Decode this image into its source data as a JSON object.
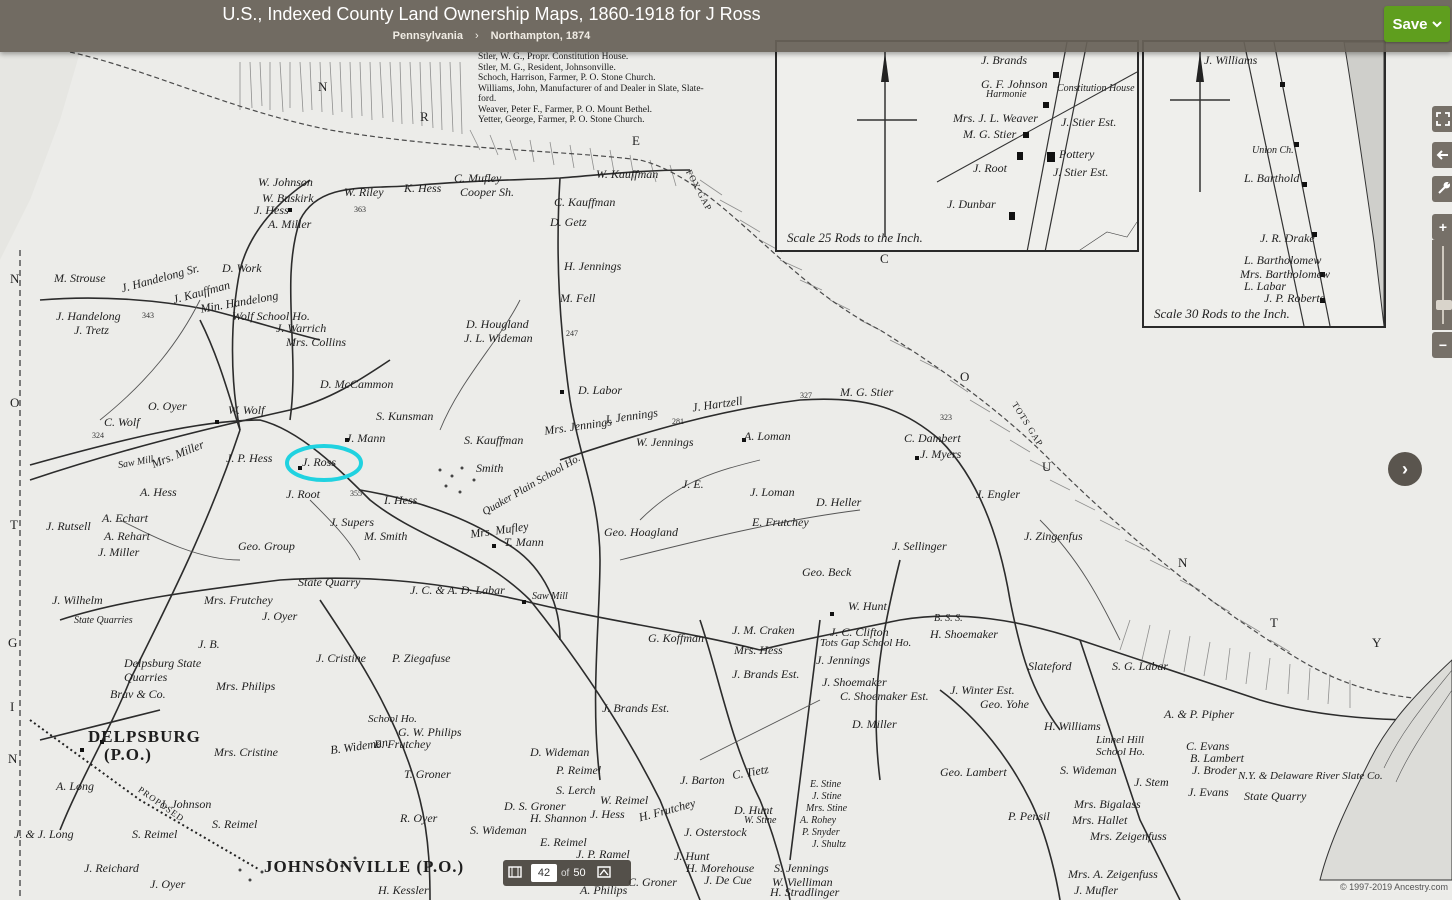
{
  "header": {
    "title": "U.S., Indexed County Land Ownership Maps, 1860-1918 for J Ross",
    "breadcrumb_state": "Pennsylvania",
    "breadcrumb_separator": "›",
    "breadcrumb_location": "Northampton, 1874",
    "save_label": "Save",
    "save_color": "#5f9e1e"
  },
  "tools": {
    "fullscreen_icon": "fullscreen-icon",
    "back_icon": "back-arrow-icon",
    "tools_icon": "wrench-icon",
    "zoom_in": "+",
    "zoom_out": "−",
    "next_icon": "›"
  },
  "pager": {
    "current": "42",
    "of": "of",
    "total": "50"
  },
  "copyright": "© 1997-2019 Ancestry.com",
  "highlight_color": "#20d2e0",
  "map": {
    "legend": [
      "Stler, W. G., Propr. Constitution House.",
      "Stler, M. G., Resident, Johnsonville.",
      "Schoch, Harrison, Farmer, P. O. Stone Church.",
      "Williams, John, Manufacturer of and Dealer in Slate, Slate-",
      "    ford.",
      "Weaver, Peter F., Farmer, P. O. Mount Bethel.",
      "Yetter, George, Farmer, P. O. Stone Church."
    ],
    "inset1_scale": "Scale 25 Rods to the Inch.",
    "inset2_scale": "Scale 30 Rods to the Inch.",
    "labels": {
      "l1": "W. Johnson",
      "l2": "W. Buskirk",
      "l3": "J. Hess",
      "l4": "A. Miller",
      "l5": "W. Riley",
      "l6": "K. Hess",
      "l7": "C. Mufley",
      "l8": "Cooper Sh.",
      "l9": "W. Kauffman",
      "l10": "C. Kauffman",
      "l11": "D. Getz",
      "l12": "H. Jennings",
      "l13": "M. Fell",
      "l14": "M. Strouse",
      "l15": "J. Handelong Sr.",
      "l16": "J. Kauffman",
      "l17": "Min. Handelong",
      "l18": "D. Work",
      "l19": "J. Handelong",
      "l20": "J. Tretz",
      "l21": "Wolf School Ho.",
      "l22": "J. Warrich",
      "l23": "Mrs. Collins",
      "l24": "D. Hougland",
      "l25": "J. L. Wideman",
      "l26": "D. McCammon",
      "l27": "D. Labor",
      "l28": "O. Oyer",
      "l29": "C. Wolf",
      "l30": "W. Wolf",
      "l31": "S. Kunsman",
      "l32": "J. Mann",
      "l33": "J. Jennings",
      "l34": "Mrs. Jennings",
      "l35": "J. Hartzell",
      "l36": "M. G. Stier",
      "l37": "S. Kauffman",
      "l38": "W. Jennings",
      "l39": "A. Loman",
      "l40": "C. Dambert",
      "l41": "J. Myers",
      "l42": "J. P. Hess",
      "l43": "J. Ross",
      "l44": "Smith",
      "l45": "Quaker Plain School Ho.",
      "l46": "Mrs. Miller",
      "l47": "Saw Mill",
      "l48": "J. E.",
      "l49": "J. Loman",
      "l50": "D. Heller",
      "l51": "J. Engler",
      "l52": "A. Hess",
      "l53": "J. Root",
      "l54": "I. Hess",
      "l55": "A. Echart",
      "l56": "J. Rutsell",
      "l57": "A. Rehart",
      "l58": "J. Supers",
      "l59": "M. Smith",
      "l60": "Mrs. Mufley",
      "l61": "T. Mann",
      "l62": "Geo. Hoagland",
      "l63": "E. Frutchey",
      "l64": "J. Zingenfus",
      "l65": "J. Miller",
      "l66": "Geo. Group",
      "l67": "J. Sellinger",
      "l68": "Geo. Beck",
      "l69": "State Quarry",
      "l70": "J. C. & A. D. Labar",
      "l71": "Saw Mill",
      "l72": "J. Wilhelm",
      "l73": "Mrs. Frutchey",
      "l74": "J. Oyer",
      "l75": "State Quarries",
      "l76": "W. Hunt",
      "l77": "B. S. S.",
      "l78": "H. Shoemaker",
      "l79": "J. B.",
      "l80": "G. Koffman",
      "l81": "J. M. Craken",
      "l82": "J. C. Clifton",
      "l83": "Tots Gap School Ho.",
      "l84": "Mrs. Hess",
      "l85": "J. Jennings",
      "l86": "Slateford",
      "l87": "S. G. Labar",
      "l88": "J. Cristine",
      "l89": "P. Ziegafuse",
      "l90": "Delpsburg State Quarries",
      "l91": "Mrs. Philips",
      "l92": "J. Brands Est.",
      "l93": "J. Shoemaker",
      "l94": "C. Shoemaker Est.",
      "l95": "J. Winter Est.",
      "l96": "Geo. Yohe",
      "l97": "Brav & Co.",
      "l98": "J. Brands Est.",
      "l99": "D. Miller",
      "l100": "H. Williams",
      "l101": "A. & P. Pipher",
      "l102": "School Ho.",
      "l103": "G. W. Philips",
      "l104": "Mrs. Cristine",
      "l105": "B. Wideman",
      "l106": "E. Frutchey",
      "l107": "Linnel Hill School Ho.",
      "l108": "C. Evans",
      "l109": "B. Lambert",
      "l110": "J. Broder",
      "l111": "D. Wideman",
      "l112": "P. Reimel",
      "l113": "J. Barton",
      "l114": "C. Tietz",
      "l115": "Geo. Lambert",
      "l116": "S. Wideman",
      "l117": "N.Y. & Delaware River Slate Co.",
      "l118": "A. Long",
      "l119": "T. Groner",
      "l120": "S. Lerch",
      "l121": "W. Reimel",
      "l122": "E. Stine",
      "l123": "J. Stine",
      "l124": "Mrs. Stine",
      "l125": "J. Stem",
      "l126": "J. Evans",
      "l127": "State Quarry",
      "l128": "J. Johnson",
      "l129": "D. S. Groner",
      "l130": "H. Shannon",
      "l131": "J. Hess",
      "l132": "H. Frutchey",
      "l133": "D. Hunt",
      "l134": "W. Stine",
      "l135": "A. Rohey",
      "l136": "P. Snyder",
      "l137": "J. Shultz",
      "l138": "P. Pensil",
      "l139": "Mrs. Bigalass",
      "l140": "Mrs. Hallet",
      "l141": "Mrs. Zeigenfuss",
      "l142": "J. & J. Long",
      "l143": "S. Reimel",
      "l144": "S. Reimel",
      "l145": "R. Oyer",
      "l146": "S. Wideman",
      "l147": "J. Osterstock",
      "l148": "J. Reichard",
      "l149": "J. Oyer",
      "l150": "H. Kessler",
      "l151": "E. Reimel",
      "l152": "J. P. Ramel",
      "l153": "A. Philips",
      "l154": "J. Hunt",
      "l155": "H. Morehouse",
      "l156": "J. De Cue",
      "l157": "S. Jennings",
      "l158": "W. Vielliman",
      "l159": "H. Stradlinger",
      "l160": "C. Groner",
      "l161": "Mrs. A. Zeigenfuss",
      "l162": "J. Mufler",
      "l163": "DELPSBURG",
      "l164": "(P.O.)",
      "l165": "JOHNSONVILLE (P.O.)",
      "l166": "N",
      "l167": "R",
      "l168": "E",
      "l169": "R",
      "l170": "I",
      "l171": "C",
      "l172": "O",
      "l173": "U",
      "l174": "N",
      "l175": "T",
      "l176": "Y",
      "l177": "FOX GAP",
      "l178": "TOTS GAP",
      "l179": "N",
      "l180": "O",
      "l181": "T",
      "l182": "G",
      "l183": "I",
      "l184": "N",
      "l185": "PROPOSED",
      "l186": "Pottery",
      "l187": "J. Stier Est.",
      "l188": "J. Root",
      "l189": "J. Dunbar",
      "l190": "M. G. Stier",
      "l191": "Mrs. J. L. Weaver",
      "l192": "J. Brands",
      "l193": "Constitution House",
      "l194": "J. Stier Est.",
      "l195": "Union Ch.",
      "l196": "L. Barthold",
      "l197": "J. R. Drake",
      "l198": "L. Bartholomew",
      "l199": "Mrs. Bartholomew",
      "l200": "L. Labar",
      "l201": "J. P. Roberts",
      "l202": "J. Williams",
      "l203": "G. F. Johnson",
      "l204": "Harmonie"
    }
  }
}
